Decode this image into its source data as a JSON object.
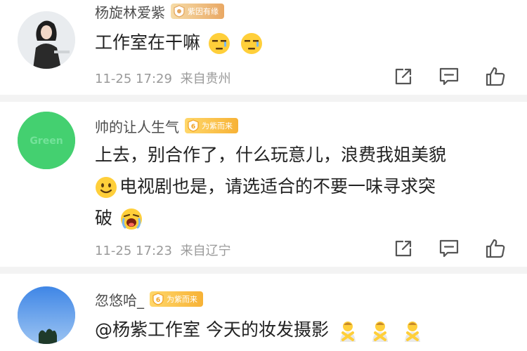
{
  "comments": [
    {
      "username": "杨旋林爱紫",
      "badge": "紫因有缘",
      "text_part1": "工作室在干嘛",
      "date": "11-25",
      "time": "17:29",
      "location": "来自贵州"
    },
    {
      "username": "帅的让人生气",
      "badge": "为紫而来",
      "badge_level": "6",
      "avatar_text": "Green",
      "line1": "上去，别合作了，什么玩意儿，浪费我姐美貌",
      "line2": "电视剧也是，请选适合的不要一味寻求突",
      "line3": "破",
      "date": "11-25",
      "time": "17:23",
      "location": "来自辽宁"
    },
    {
      "username": "忽悠哈_",
      "badge": "为紫而来",
      "badge_level": "6",
      "text": "@杨紫工作室 今天的妆发摄影"
    }
  ],
  "colors": {
    "text": "#222222",
    "meta": "#9a9a9a",
    "username": "#4d4d4d",
    "badge_gold": "#f7b236",
    "divider": "#f3f3f3"
  }
}
